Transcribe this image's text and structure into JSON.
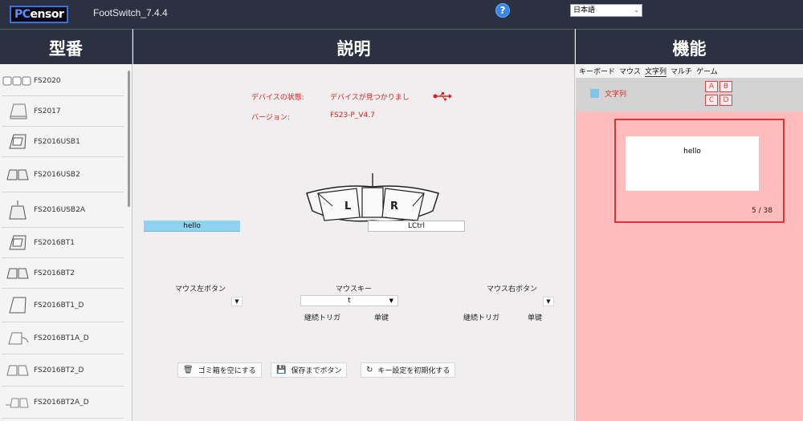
{
  "app": {
    "logo_pc": "PC",
    "logo_rest": "ensor",
    "title": "FootSwitch_7.4.4",
    "help_icon": "?",
    "language": "日本語"
  },
  "headers": {
    "model": "型番",
    "description": "説明",
    "function": "機能"
  },
  "models": [
    {
      "label": "FS2020",
      "icon": "triple-pedal-icon"
    },
    {
      "label": "FS2017",
      "icon": "single-pedal-icon"
    },
    {
      "label": "FS2016USB1",
      "icon": "single-pedal-icon"
    },
    {
      "label": "FS2016USB2",
      "icon": "double-pedal-icon"
    },
    {
      "label": "FS2016USB2A",
      "icon": "handle-pedal-icon"
    },
    {
      "label": "FS2016BT1",
      "icon": "single-pedal-icon"
    },
    {
      "label": "FS2016BT2",
      "icon": "double-pedal-icon"
    },
    {
      "label": "FS2016BT1_D",
      "icon": "single-pedal-icon"
    },
    {
      "label": "FS2016BT1A_D",
      "icon": "wired-pedal-icon"
    },
    {
      "label": "FS2016BT2_D",
      "icon": "double-pedal-icon"
    },
    {
      "label": "FS2016BT2A_D",
      "icon": "wired-double-pedal-icon"
    }
  ],
  "device": {
    "status_label": "デバイスの状態:",
    "status_value": "デバイスが見つかりまし",
    "version_label": "バージョン:",
    "version_value": "FS23-P_V4.7"
  },
  "pedals": {
    "left_letter": "L",
    "right_letter": "R",
    "left_value": "hello",
    "right_value": "LCtrl"
  },
  "mouse": {
    "left_button": "マウス左ボタン",
    "mouse_key": "マウスキー",
    "right_button": "マウス右ボタン",
    "mouse_key_value": "t",
    "continuous_trigger": "継続トリガ",
    "single_key": "单键"
  },
  "actions": {
    "empty_trash": "ゴミ箱を空にする",
    "save": "保存までボタン",
    "reset": "キー設定を初期化する"
  },
  "function_tabs": [
    "キーボード",
    "マウス",
    "文字列",
    "マルチ",
    "ゲーム"
  ],
  "string_panel": {
    "label": "文字列",
    "buttons": [
      "A",
      "B",
      "C",
      "D"
    ],
    "text": "hello",
    "counter": "5 / 38"
  },
  "colors": {
    "dark_bar": "#2b3140",
    "right_bg": "#ffbcbc",
    "accent_red": "#e02020",
    "field_blue": "#8fd3f1"
  }
}
